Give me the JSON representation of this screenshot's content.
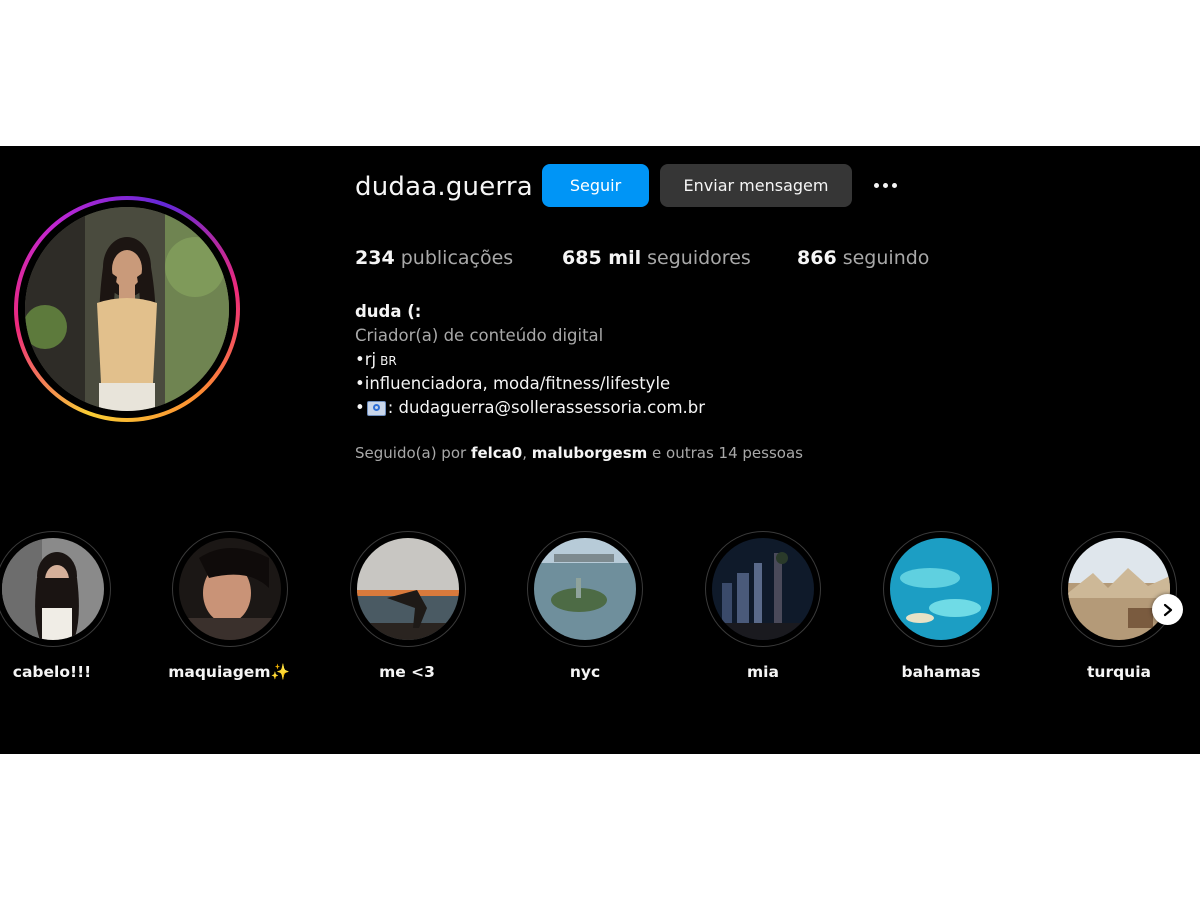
{
  "profile": {
    "username": "dudaa.guerra",
    "follow_label": "Seguir",
    "message_label": "Enviar mensagem",
    "more_icon": "more-options-icon"
  },
  "stats": {
    "posts_count": "234",
    "posts_label": "publicações",
    "followers_count": "685 mil",
    "followers_label": "seguidores",
    "following_count": "866",
    "following_label": "seguindo"
  },
  "bio": {
    "name": "duda (:",
    "category": "Criador(a) de conteúdo digital",
    "line1": "•rj",
    "line1_flag": "BR",
    "line2": "•influenciadora, moda/fitness/lifestyle",
    "line3_prefix": "•",
    "line3_icon": "email-icon",
    "line3_text": ": dudaguerra@sollerassessoria.com.br"
  },
  "followed_by": {
    "prefix": "Seguido(a) por ",
    "user1": "felca0",
    "separator": ", ",
    "user2": "maluborgesm",
    "suffix": " e outras 14 pessoas"
  },
  "highlights": [
    {
      "label": "cabelo!!!"
    },
    {
      "label": "maquiagem✨"
    },
    {
      "label": "me <3"
    },
    {
      "label": "nyc"
    },
    {
      "label": "mia"
    },
    {
      "label": "bahamas"
    },
    {
      "label": "turquia"
    }
  ],
  "colors": {
    "background": "#000000",
    "primary_button": "#0095f6",
    "secondary_button": "#363636",
    "muted_text": "#a8a8a8"
  }
}
